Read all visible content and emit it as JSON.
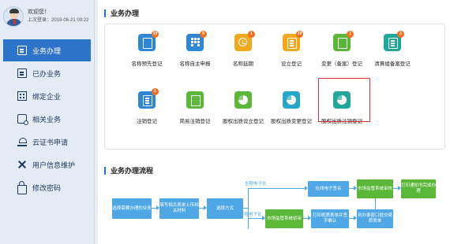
{
  "user": {
    "welcome": "欢迎您！",
    "last_login": "上次登录：2019-06-21 09:22"
  },
  "nav": [
    {
      "label": "业务办理",
      "icon": "file-edit-icon",
      "active": true
    },
    {
      "label": "已办业务",
      "icon": "file-list-icon",
      "active": false
    },
    {
      "label": "绑定企业",
      "icon": "building-icon",
      "active": false
    },
    {
      "label": "相关业务",
      "icon": "search-doc-icon",
      "active": false
    },
    {
      "label": "云证书申请",
      "icon": "cloud-cert-icon",
      "active": false
    },
    {
      "label": "用户信息维护",
      "icon": "tools-icon",
      "active": false
    },
    {
      "label": "修改密码",
      "icon": "lock-icon",
      "active": false
    }
  ],
  "section_business": "业务办理",
  "tiles": [
    {
      "label": "名称预先登记",
      "icon": "document-edit-icon",
      "color": "#2e86d7",
      "badge": "19"
    },
    {
      "label": "名称自主申报",
      "icon": "building-icon",
      "color": "#2e86d7",
      "badge": "9"
    },
    {
      "label": "名称延期",
      "icon": "clock-icon",
      "color": "#f2a81d",
      "badge": "1"
    },
    {
      "label": "设立登记",
      "icon": "document-write-icon",
      "color": "#f2a81d",
      "badge": "19"
    },
    {
      "label": "变更（备案）登记",
      "icon": "document-change-icon",
      "color": "#5ab738",
      "badge": "1"
    },
    {
      "label": "清算组备案登记",
      "icon": "document-list-icon",
      "color": "#1fa89a",
      "badge": "2"
    },
    {
      "label": "注销登记",
      "icon": "document-cancel-icon",
      "color": "#2e86d7",
      "badge": "1"
    },
    {
      "label": "简易注销登记",
      "icon": "document-quick-icon",
      "color": "#5ab738",
      "badge": ""
    },
    {
      "label": "股权出质设立登记",
      "icon": "pie-chart-icon",
      "color": "#5ab738",
      "badge": ""
    },
    {
      "label": "股权出质变更登记",
      "icon": "pie-chart-icon",
      "color": "#25a7c9",
      "badge": ""
    },
    {
      "label": "股权出质注销登记",
      "icon": "pie-chart-icon",
      "color": "#1fa89a",
      "badge": "",
      "highlighted": true
    }
  ],
  "section_flow": "业务办理流程",
  "flow": {
    "step1": "选择需要办理的业务",
    "step2": "填写相关表单上传相关材料",
    "step3": "选择方式",
    "branch_full": "全程电子化",
    "branch_half": "半程电子化",
    "sign_online": "在线电子签名",
    "review_full": "市场监管系统审核",
    "notice": "打印通知书完成办理",
    "review_half": "市场监管系统初审",
    "print_sign": "打印纸质表单并签字确认",
    "submit_paper": "到办事窗口提交纸质表单"
  }
}
